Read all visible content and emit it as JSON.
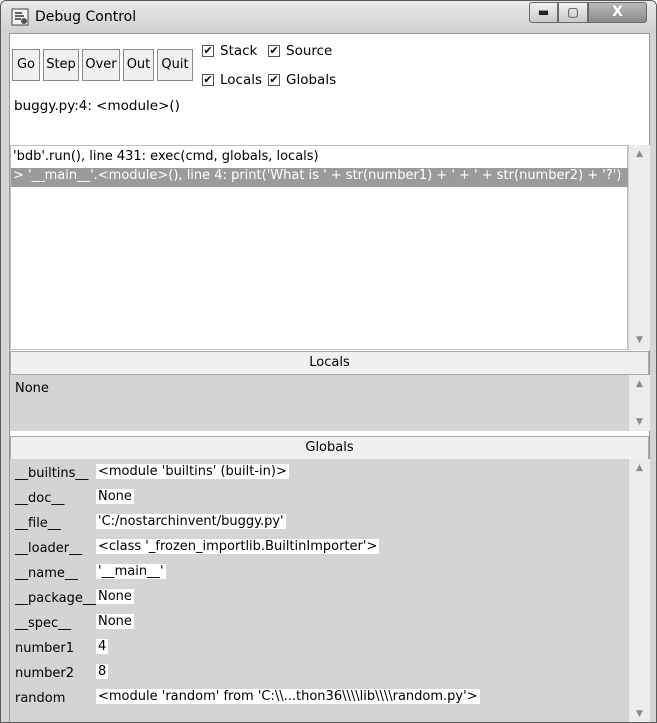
{
  "window": {
    "title": "Debug Control",
    "minimize": "▬",
    "maximize": "▢",
    "close": "X"
  },
  "toolbar": {
    "buttons": [
      "Go",
      "Step",
      "Over",
      "Out",
      "Quit"
    ],
    "checkboxes": {
      "stack": {
        "label": "Stack",
        "checked": true
      },
      "source": {
        "label": "Source",
        "checked": true
      },
      "locals": {
        "label": "Locals",
        "checked": true
      },
      "globals": {
        "label": "Globals",
        "checked": true
      }
    },
    "check_glyph": "✔"
  },
  "status": "buggy.py:4: <module>()",
  "stack": {
    "lines": [
      "'bdb'.run(), line 431: exec(cmd, globals, locals)",
      "> '__main__'.<module>(), line 4: print('What is ' + str(number1) + ' + ' + str(number2) + '?')"
    ]
  },
  "locals": {
    "header": "Locals",
    "value": "None"
  },
  "globals": {
    "header": "Globals",
    "rows": [
      {
        "name": "__builtins__",
        "value": "<module 'builtins' (built-in)>"
      },
      {
        "name": "__doc__",
        "value": "None"
      },
      {
        "name": "__file__",
        "value": "'C:/nostarchinvent/buggy.py'"
      },
      {
        "name": "__loader__",
        "value": "<class '_frozen_importlib.BuiltinImporter'>"
      },
      {
        "name": "__name__",
        "value": "'__main__'"
      },
      {
        "name": "__package__",
        "value": "None"
      },
      {
        "name": "__spec__",
        "value": "None"
      },
      {
        "name": "number1",
        "value": "4"
      },
      {
        "name": "number2",
        "value": "8"
      },
      {
        "name": "random",
        "value": "<module 'random' from 'C:\\\\...thon36\\\\\\\\lib\\\\\\\\random.py'>"
      }
    ]
  },
  "scroll": {
    "up": "▲",
    "down": "▼"
  }
}
